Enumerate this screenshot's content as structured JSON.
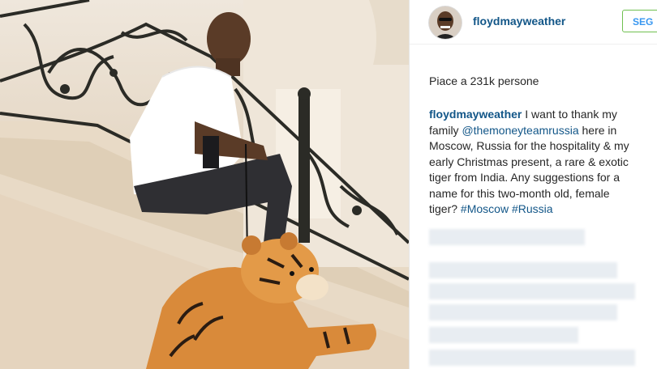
{
  "post": {
    "username": "floydmayweather",
    "follow_label": "SEG",
    "likes_text": "Piace a 231k persone",
    "caption": {
      "user": "floydmayweather",
      "part1": " I want to thank my family ",
      "mention": "@themoneyteamrussia",
      "part2": " here in Moscow, Russia for the hospitality & my early Christmas present, a rare & exotic tiger from India. Any suggestions for a name for this two-month old, female tiger? ",
      "hashtag1": "#Moscow",
      "space": " ",
      "hashtag2": "#Russia"
    }
  },
  "icons": {
    "avatar": "profile-photo",
    "photo": "man-with-tiger-cub-photo"
  },
  "colors": {
    "link_blue": "#125688",
    "follow_border": "#70c050",
    "follow_text": "#3897f0"
  }
}
